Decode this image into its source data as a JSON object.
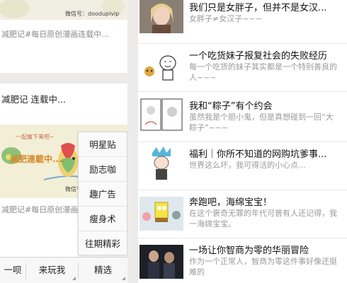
{
  "left_feed": {
    "card1": {
      "watermark": "微信号：doodupivip",
      "caption": "减肥记#每日原创漫画连载中..."
    },
    "card2": {
      "title": "减肥记 连载中...",
      "image_text": "減肥連載中....",
      "image_sub": "一起瘦下来吧~",
      "watermark": "微信号：",
      "caption": "减肥记#每日原创漫画连载中..."
    }
  },
  "tab_bar": {
    "tabs": [
      {
        "label": "一呗"
      },
      {
        "label": "来玩我"
      },
      {
        "label": "精选"
      }
    ]
  },
  "popup_menu": {
    "items": [
      {
        "label": "明星贴"
      },
      {
        "label": "励志咖"
      },
      {
        "label": "趣广告"
      },
      {
        "label": "瘦身术"
      },
      {
        "label": "往期精彩"
      }
    ]
  },
  "articles": [
    {
      "title": "我们只是女胖子，但并不是女汉...",
      "desc": "女胖子≠女汉子~~~",
      "thumb": "crying-girl-thumbnail"
    },
    {
      "title": "一个吃货妹子报复社会的失败经历",
      "desc": "每一个吃货的妹子其实都是一个特别善良的人~~~",
      "thumb": "cartoon-foodie-thumbnail"
    },
    {
      "title": "我和“粽子”有个约会",
      "desc": "虽然我是个胆小鬼，但是真想碰到一回“大粽子”~~~",
      "thumb": "comic-zongzi-thumbnail"
    },
    {
      "title": "福利｜你所不知道的网购坑爹事...",
      "desc": "世界这么坏，我可得活的小心点...",
      "thumb": "anime-character-thumbnail"
    },
    {
      "title": "奔跑吧，海绵宝宝！",
      "desc": "在这个褒奇无罪的年代可曾有人还记得，我一海绵宝宝。",
      "thumb": "spongebob-thumbnail"
    },
    {
      "title": "一场让你智商为零的华丽冒险",
      "desc": "作为一个正常人，智商为零这件事好像还挺难的",
      "thumb": "movie-poster-thumbnail"
    }
  ],
  "colors": {
    "background": "#ecebea",
    "card": "#ffffff",
    "title_text": "#111111",
    "desc_text": "#9a9a9a"
  }
}
